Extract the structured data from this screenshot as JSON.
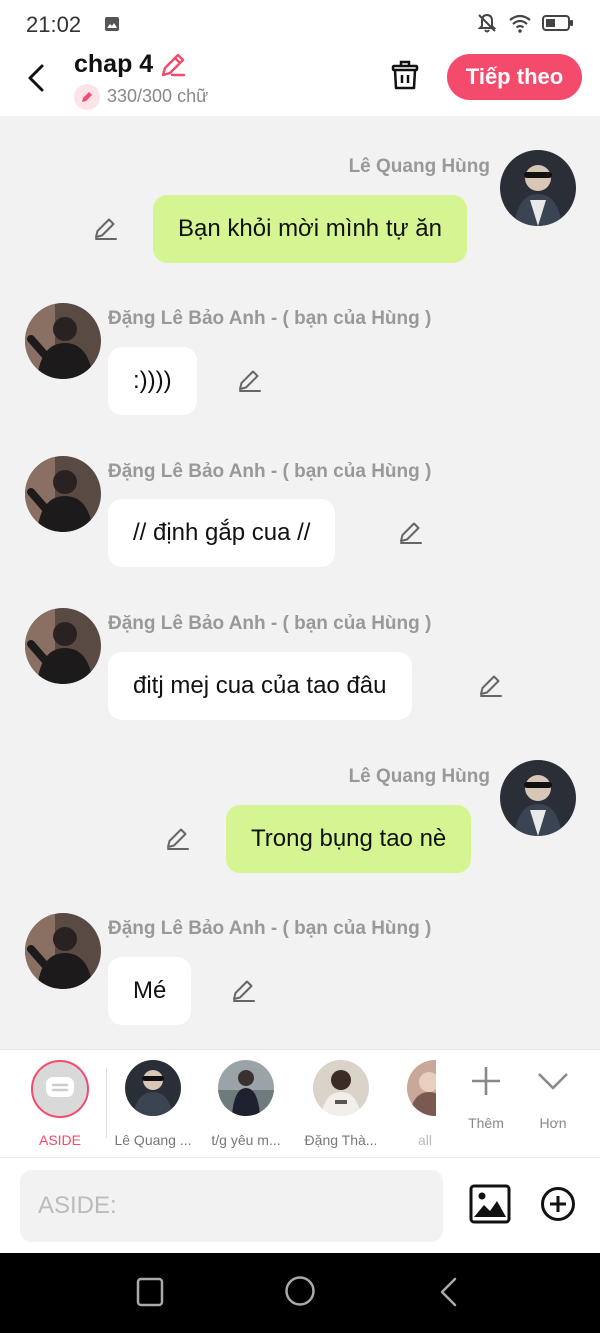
{
  "status_bar": {
    "time": "21:02"
  },
  "header": {
    "title": "chap 4",
    "word_count": "330/300 chữ",
    "next_label": "Tiếp theo"
  },
  "messages": [
    {
      "side": "me",
      "name": "Lê Quang Hùng",
      "text": "Bạn khỏi mời mình tự ăn"
    },
    {
      "side": "other",
      "name": "Đặng Lê Bảo Anh - ( bạn của Hùng )",
      "text": ":))))"
    },
    {
      "side": "other",
      "name": "Đặng Lê Bảo Anh - ( bạn của Hùng )",
      "text": "// định gắp cua //"
    },
    {
      "side": "other",
      "name": "Đặng Lê Bảo Anh - ( bạn của Hùng )",
      "text": "đitj mej cua của tao đâu"
    },
    {
      "side": "me",
      "name": "Lê Quang Hùng",
      "text": "Trong bụng tao nè"
    },
    {
      "side": "other",
      "name": "Đặng Lê Bảo Anh - ( bạn của Hùng )",
      "text": "Mé"
    }
  ],
  "characters": [
    {
      "label": "ASIDE",
      "active": true
    },
    {
      "label": "Lê Quang ..."
    },
    {
      "label": "t/g yêu m..."
    },
    {
      "label": "Đặng Thà..."
    },
    {
      "label": "all"
    }
  ],
  "tools": {
    "add_label": "Thêm",
    "more_label": "Hơn"
  },
  "input": {
    "placeholder": "ASIDE:"
  },
  "colors": {
    "accent": "#f44a6b",
    "my_bubble": "#d5f592",
    "other_bubble": "#ffffff"
  }
}
